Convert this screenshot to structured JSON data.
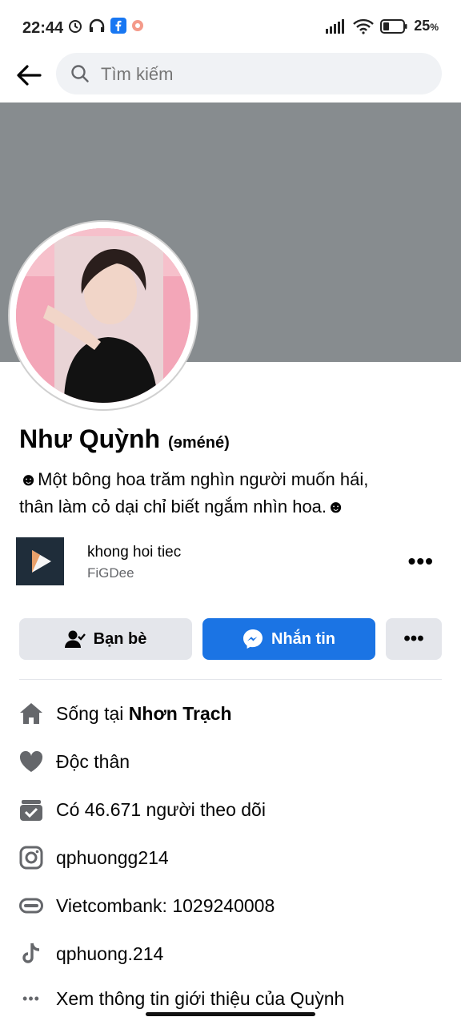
{
  "status": {
    "time": "22:44",
    "battery": "25"
  },
  "search": {
    "placeholder": "Tìm kiếm"
  },
  "profile": {
    "name": "Như Quỳnh",
    "alt_name": "(ɘméné)",
    "bio_line1": "☻Một bông hoa trăm nghìn người muốn hái,",
    "bio_line2": "thân làm cỏ dại chỉ biết ngắm nhìn hoa.☻"
  },
  "music": {
    "title": "khong hoi tiec",
    "artist": "FiGDee"
  },
  "actions": {
    "friends": "Bạn bè",
    "message": "Nhắn tin"
  },
  "info": {
    "lives_prefix": "Sống tại ",
    "lives_city": "Nhơn Trạch",
    "relationship": "Độc thân",
    "followers": "Có 46.671 người theo dõi",
    "instagram": "qphuongg214",
    "bank": "Vietcombank: 1029240008",
    "tiktok": "qphuong.214",
    "see_more": "Xem thông tin giới thiệu của Quỳnh"
  },
  "colors": {
    "primary": "#1b74e4",
    "cover": "#878c8f",
    "icon": "#65676b"
  }
}
